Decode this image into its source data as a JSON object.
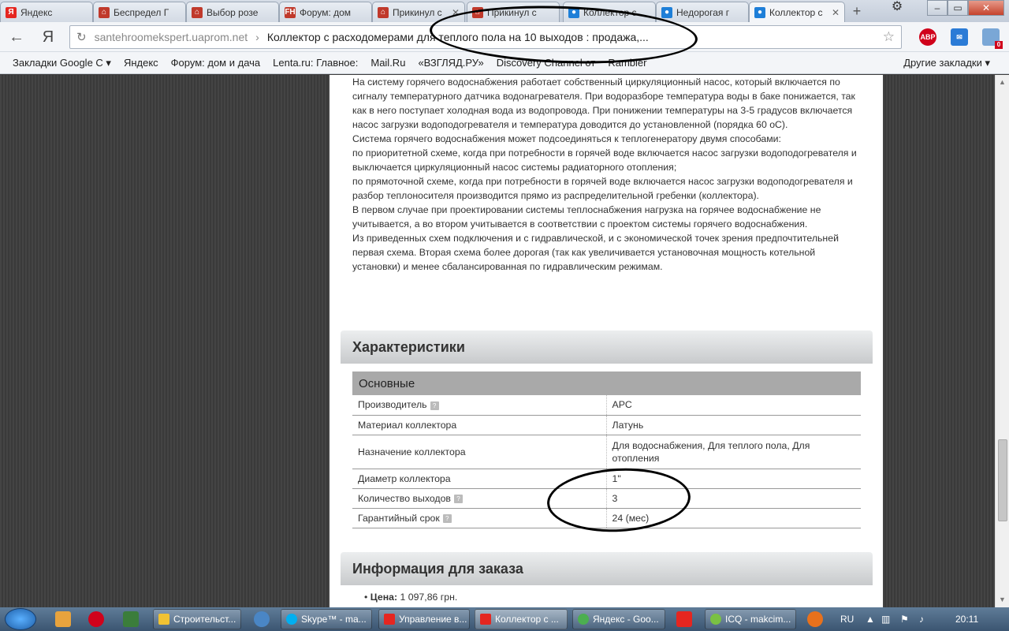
{
  "browser": {
    "tabs": [
      {
        "title": "Яндекс",
        "icon": "yandex-icon",
        "color": "#e52620"
      },
      {
        "title": "Беспредел Г",
        "icon": "house-icon",
        "color": "#c0392b"
      },
      {
        "title": "Выбор розе",
        "icon": "house-icon",
        "color": "#c0392b"
      },
      {
        "title": "Форум: дом",
        "icon": "fh-icon",
        "color": "#c0392b"
      },
      {
        "title": "Прикинул с",
        "icon": "house-icon",
        "color": "#c0392b"
      },
      {
        "title": "Прикинул с",
        "icon": "house-icon",
        "color": "#c0392b"
      },
      {
        "title": "Коллектор с",
        "icon": "drop-icon",
        "color": "#1e7fd8"
      },
      {
        "title": "Недорогая г",
        "icon": "drop-icon",
        "color": "#1e7fd8"
      },
      {
        "title": "Коллектор с",
        "icon": "drop-icon",
        "color": "#1e7fd8"
      }
    ],
    "new_tab": "+",
    "window_controls": {
      "minimize": "–",
      "maximize": "▭",
      "close": "✕",
      "settings": "⚙"
    },
    "nav": {
      "back": "←",
      "yandex": "Я"
    },
    "address": {
      "host": "santehroomekspert.uaprom.net",
      "separator": "›",
      "page_title": "Коллектор с расходомерами для теплого пола на 10 выходов : продажа,..."
    },
    "extensions": {
      "abp": "ABP",
      "mail_badge": "0"
    },
    "bookmarks": [
      "Закладки Google С ▾",
      "Яндекс",
      "Форум: дом и дача",
      "Lenta.ru: Главное:",
      "Mail.Ru",
      "«ВЗГЛЯД.РУ»",
      "Discovery Channel от",
      "Rambler"
    ],
    "other_bookmarks": "Другие закладки ▾"
  },
  "article": {
    "paragraphs": [
      "На систему горячего водоснабжения работает собственный циркуляционный насос, который включается по сигналу температурного датчика водонагревателя. При водоразборе температура воды в баке понижается, так как в него поступает холодная вода из водопровода. При понижении температуры на 3-5 градусов включается насос загрузки водоподогревателя и температура доводится до установленной (порядка 60 оС).",
      "Система горячего водоснабжения может подсоединяться к теплогенератору двумя способами:",
      "по приоритетной схеме, когда при потребности в горячей воде включается насос загрузки водоподогревателя и выключается циркуляционный насос системы радиаторного отопления;",
      "по прямоточной схеме, когда при потребности в горячей воде включается насос загрузки водоподогревателя и разбор теплоносителя производится прямо из распределительной гребенки (коллектора).",
      "В первом случае при проектировании системы теплоснабжения нагрузка на горячее водоснабжение не учитывается, а во втором учитывается в соответствии с проектом системы горячего водоснабжения.",
      "Из приведенных схем подключения и с гидравлической, и с экономической точек зрения предпочтительней первая схема. Вторая схема более дорогая (так как увеличивается установочная мощность котельной установки) и менее сбалансированная по гидравлическим режимам."
    ]
  },
  "specs": {
    "title": "Характеристики",
    "group": "Основные",
    "rows": [
      {
        "key": "Производитель",
        "value": "APC",
        "help": true
      },
      {
        "key": "Материал коллектора",
        "value": "Латунь",
        "help": false
      },
      {
        "key": "Назначение коллектора",
        "value": "Для водоснабжения, Для теплого пола, Для отопления",
        "help": false
      },
      {
        "key": "Диаметр коллектора",
        "value": "1\"",
        "help": false
      },
      {
        "key": "Количество выходов",
        "value": "3",
        "help": true
      },
      {
        "key": "Гарантийный срок",
        "value": "24 (мес)",
        "help": true
      }
    ]
  },
  "order": {
    "title": "Информация для заказа",
    "price_label": "Цена:",
    "price_value": "1 097,86 грн."
  },
  "taskbar": {
    "tasks": [
      {
        "label": "Строительст...",
        "color": "#f1c232"
      },
      {
        "label": "Skype™ - ma...",
        "color": "#00aff0"
      },
      {
        "label": "Управление в...",
        "color": "#e52620"
      },
      {
        "label": "Коллектор с ...",
        "color": "#e52620"
      },
      {
        "label": "Яндекс - Goo...",
        "color": "#4caf50"
      },
      {
        "label": "ICQ - makcim...",
        "color": "#7ac143"
      }
    ],
    "lang": "RU",
    "time": "20:11",
    "help_glyph": "?"
  }
}
